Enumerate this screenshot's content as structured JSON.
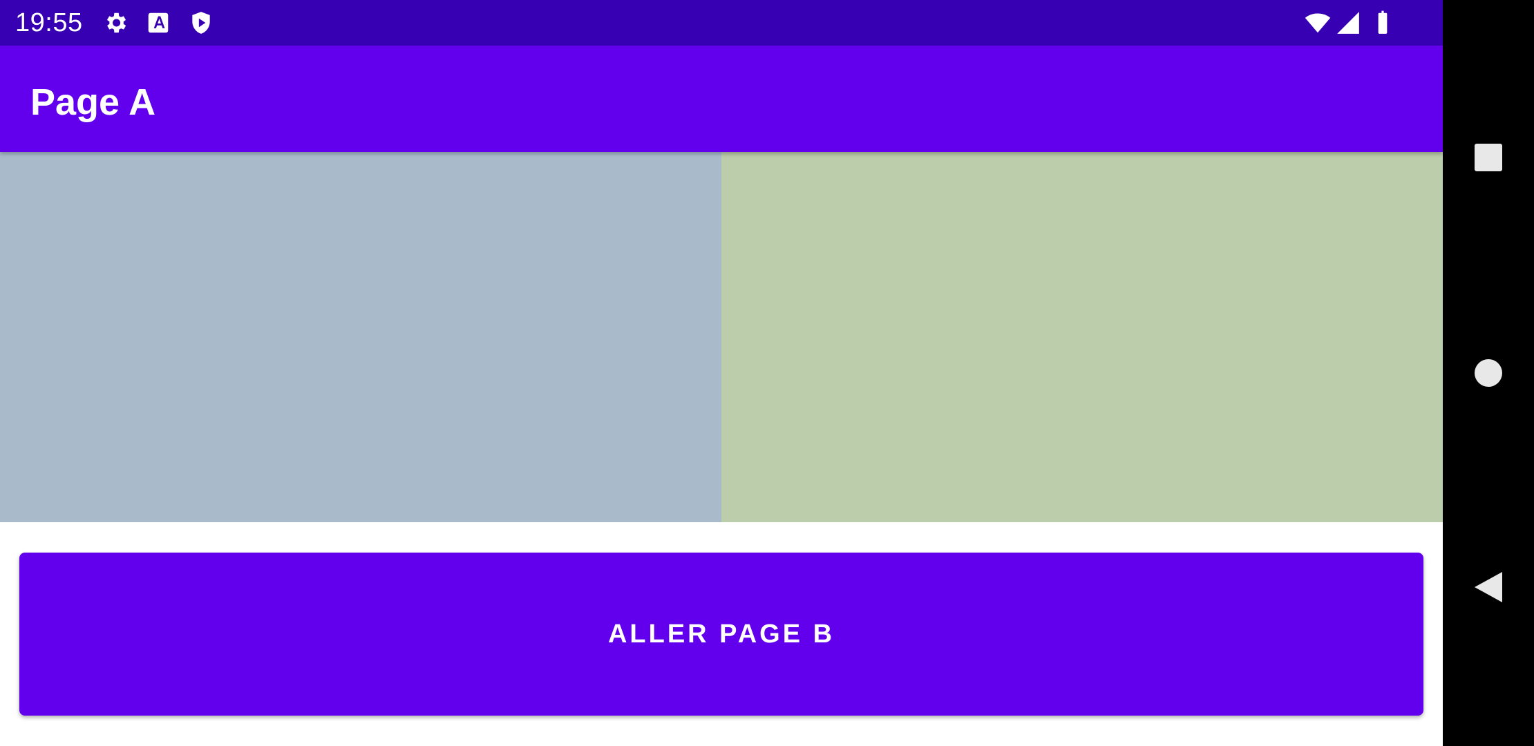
{
  "status_bar": {
    "time": "19:55",
    "icons": [
      "gear-icon",
      "text-a-icon",
      "shield-play-icon",
      "wifi-icon",
      "signal-icon",
      "battery-icon"
    ]
  },
  "app_bar": {
    "title": "Page A"
  },
  "panels": {
    "left_color": "#A9BBCB",
    "right_color": "#BBCDAB"
  },
  "main_button": {
    "label": "ALLER PAGE B"
  },
  "nav_bar": {
    "buttons": [
      "recents-square-icon",
      "home-circle-icon",
      "back-triangle-icon"
    ]
  },
  "colors": {
    "status_bar": "#3700B3",
    "primary": "#6200EE",
    "nav_bar": "#000000"
  }
}
